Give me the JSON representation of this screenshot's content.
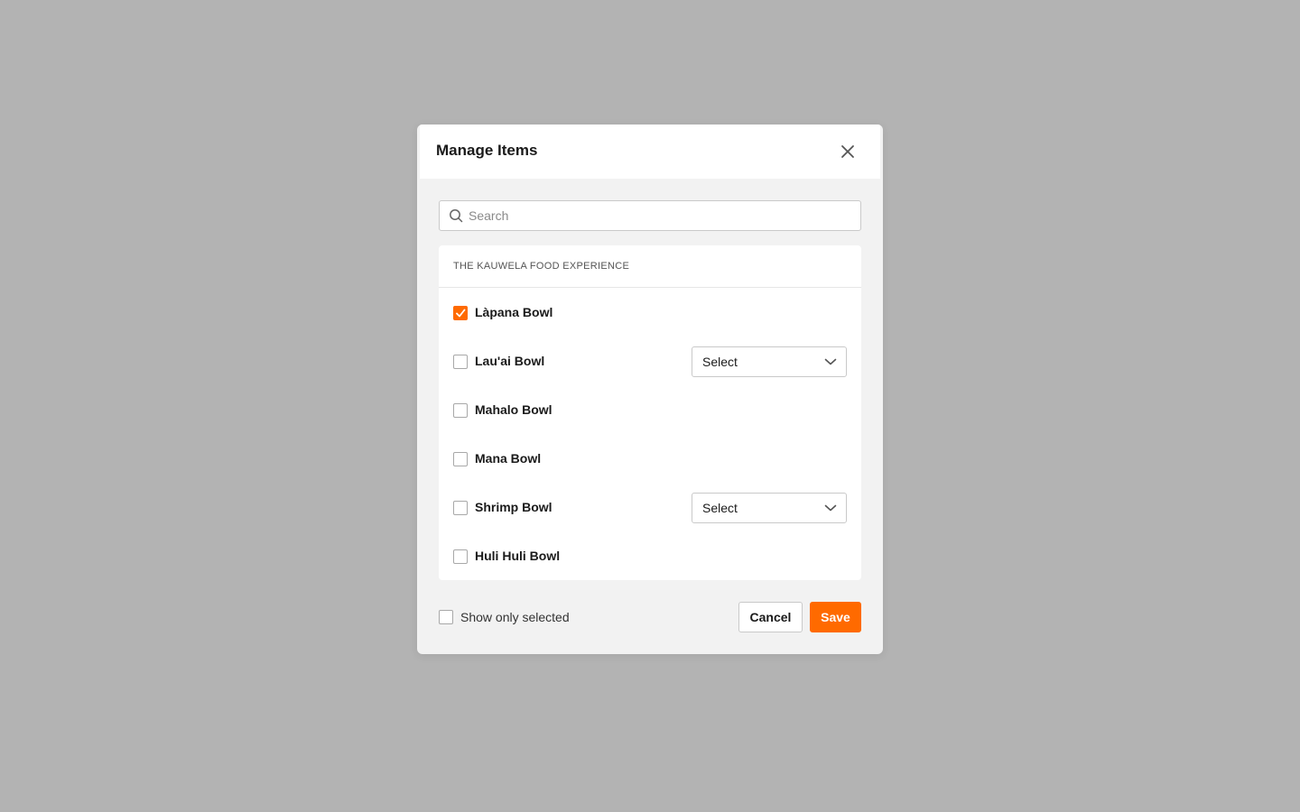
{
  "modal": {
    "title": "Manage Items",
    "close_icon": "close-icon"
  },
  "search": {
    "placeholder": "Search",
    "value": "",
    "icon": "search-icon"
  },
  "section": {
    "title": "THE KAUWELA FOOD EXPERIENCE"
  },
  "items": [
    {
      "label": "Làpana Bowl",
      "checked": true,
      "has_select": false
    },
    {
      "label": "Lau'ai Bowl",
      "checked": false,
      "has_select": true,
      "select_value": "Select"
    },
    {
      "label": "Mahalo Bowl",
      "checked": false,
      "has_select": false
    },
    {
      "label": "Mana Bowl",
      "checked": false,
      "has_select": false
    },
    {
      "label": "Shrimp Bowl",
      "checked": false,
      "has_select": true,
      "select_value": "Select"
    },
    {
      "label": "Huli Huli Bowl",
      "checked": false,
      "has_select": false
    }
  ],
  "footer": {
    "show_only_selected_label": "Show only selected",
    "show_only_selected_checked": false,
    "cancel_label": "Cancel",
    "save_label": "Save"
  },
  "colors": {
    "accent": "#ff6a00",
    "backdrop": "#b3b3b3",
    "modal_bg": "#f2f2f2"
  }
}
